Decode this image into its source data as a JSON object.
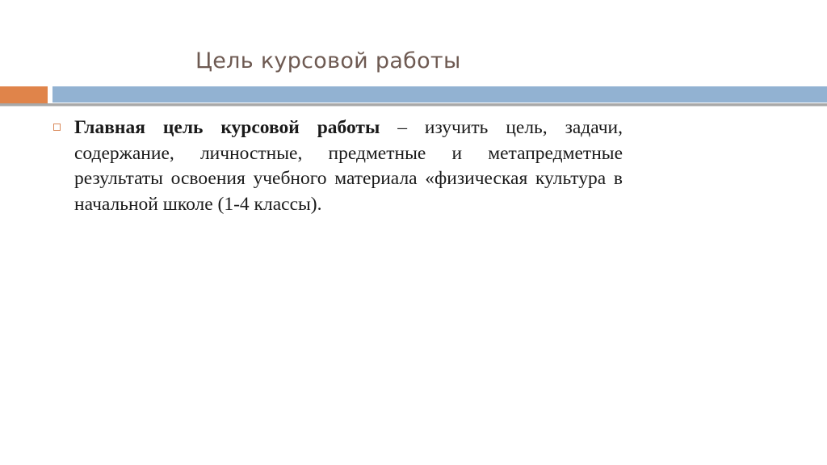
{
  "slide": {
    "title": "Цель курсовой работы",
    "bullets": [
      {
        "bold": "Главная цель курсовой работы",
        "text": " – изучить цель, задачи, содержание, личностные, предметные и метапредметные результаты освоения учебного материала «физическая культура в начальной школе (1-4 классы)."
      }
    ]
  },
  "colors": {
    "accent_orange": "#e0844a",
    "accent_blue": "#92b2d2",
    "title_color": "#6e5a52"
  }
}
